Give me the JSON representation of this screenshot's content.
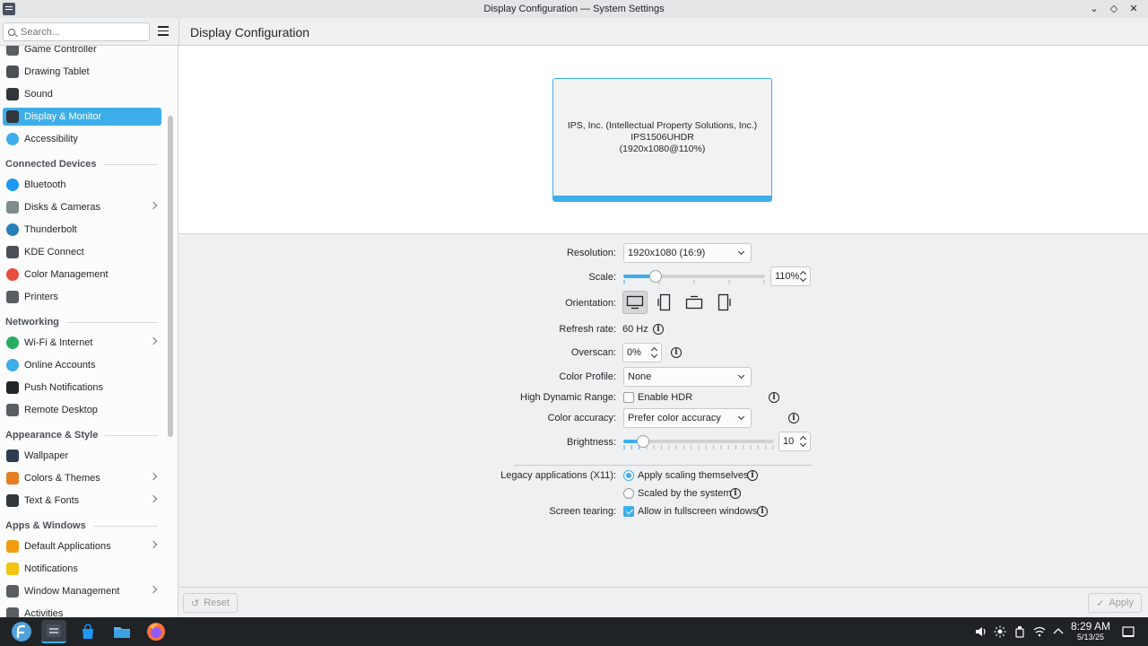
{
  "window": {
    "title": "Display Configuration — System Settings",
    "controls": [
      "minimize",
      "maximize",
      "close"
    ]
  },
  "header": {
    "search_placeholder": "Search...",
    "page_title": "Display Configuration"
  },
  "sidebar": {
    "items": [
      {
        "label": "Game Controller",
        "icon": "gamepad-icon",
        "color": "#5a5d61"
      },
      {
        "label": "Drawing Tablet",
        "icon": "tablet-icon",
        "color": "#4d5056"
      },
      {
        "label": "Sound",
        "icon": "speaker-icon",
        "color": "#31363b"
      },
      {
        "label": "Display & Monitor",
        "icon": "monitor-icon",
        "color": "#31363b",
        "selected": true
      },
      {
        "label": "Accessibility",
        "icon": "accessibility-icon",
        "color": "#3daee9"
      },
      {
        "section": "Connected Devices"
      },
      {
        "label": "Bluetooth",
        "icon": "bluetooth-icon",
        "color": "#1d99f3"
      },
      {
        "label": "Disks & Cameras",
        "icon": "disk-icon",
        "color": "#7f8c8d",
        "chevron": true
      },
      {
        "label": "Thunderbolt",
        "icon": "thunderbolt-icon",
        "color": "#2980b9"
      },
      {
        "label": "KDE Connect",
        "icon": "phone-icon",
        "color": "#4d5056"
      },
      {
        "label": "Color Management",
        "icon": "color-wheel-icon",
        "color": "#e74c3c"
      },
      {
        "label": "Printers",
        "icon": "printer-icon",
        "color": "#5a5d61"
      },
      {
        "section": "Networking"
      },
      {
        "label": "Wi-Fi & Internet",
        "icon": "globe-icon",
        "color": "#27ae60",
        "chevron": true
      },
      {
        "label": "Online Accounts",
        "icon": "globe-accounts-icon",
        "color": "#3daee9"
      },
      {
        "label": "Push Notifications",
        "icon": "pin-icon",
        "color": "#232629"
      },
      {
        "label": "Remote Desktop",
        "icon": "remote-desktop-icon",
        "color": "#5a5d61"
      },
      {
        "section": "Appearance & Style"
      },
      {
        "label": "Wallpaper",
        "icon": "wallpaper-icon",
        "color": "#2c3e50"
      },
      {
        "label": "Colors & Themes",
        "icon": "palette-icon",
        "color": "#e67e22",
        "chevron": true
      },
      {
        "label": "Text & Fonts",
        "icon": "font-icon",
        "color": "#31363b",
        "chevron": true
      },
      {
        "section": "Apps & Windows"
      },
      {
        "label": "Default Applications",
        "icon": "star-icon",
        "color": "#f39c12",
        "chevron": true
      },
      {
        "label": "Notifications",
        "icon": "bell-icon",
        "color": "#f1c40f"
      },
      {
        "label": "Window Management",
        "icon": "window-icon",
        "color": "#5a5d61",
        "chevron": true
      },
      {
        "label": "Activities",
        "icon": "activities-icon",
        "color": "#5a5d61"
      }
    ]
  },
  "monitor": {
    "line1": "IPS, Inc. (Intellectual Property Solutions, Inc.)",
    "line2": "IPS1506UHDR",
    "line3": "(1920x1080@110%)"
  },
  "settings": {
    "resolution_label": "Resolution:",
    "resolution_value": "1920x1080 (16:9)",
    "scale_label": "Scale:",
    "scale_value": "110%",
    "scale_fraction": 0.2,
    "orientation_label": "Orientation:",
    "refresh_label": "Refresh rate:",
    "refresh_value": "60 Hz",
    "overscan_label": "Overscan:",
    "overscan_value": "0%",
    "color_profile_label": "Color Profile:",
    "color_profile_value": "None",
    "hdr_label": "High Dynamic Range:",
    "hdr_option": "Enable HDR",
    "color_accuracy_label": "Color accuracy:",
    "color_accuracy_value": "Prefer color accuracy",
    "brightness_label": "Brightness:",
    "brightness_value": "10",
    "brightness_fraction": 0.1,
    "legacy_label": "Legacy applications (X11):",
    "legacy_option1": "Apply scaling themselves",
    "legacy_option2": "Scaled by the system",
    "tearing_label": "Screen tearing:",
    "tearing_option": "Allow in fullscreen windows"
  },
  "footer": {
    "reset": "Reset",
    "apply": "Apply"
  },
  "taskbar": {
    "time": "8:29 AM",
    "date": "5/13/25"
  },
  "colors": {
    "accent": "#3daee9",
    "taskbar": "#1f2326"
  }
}
